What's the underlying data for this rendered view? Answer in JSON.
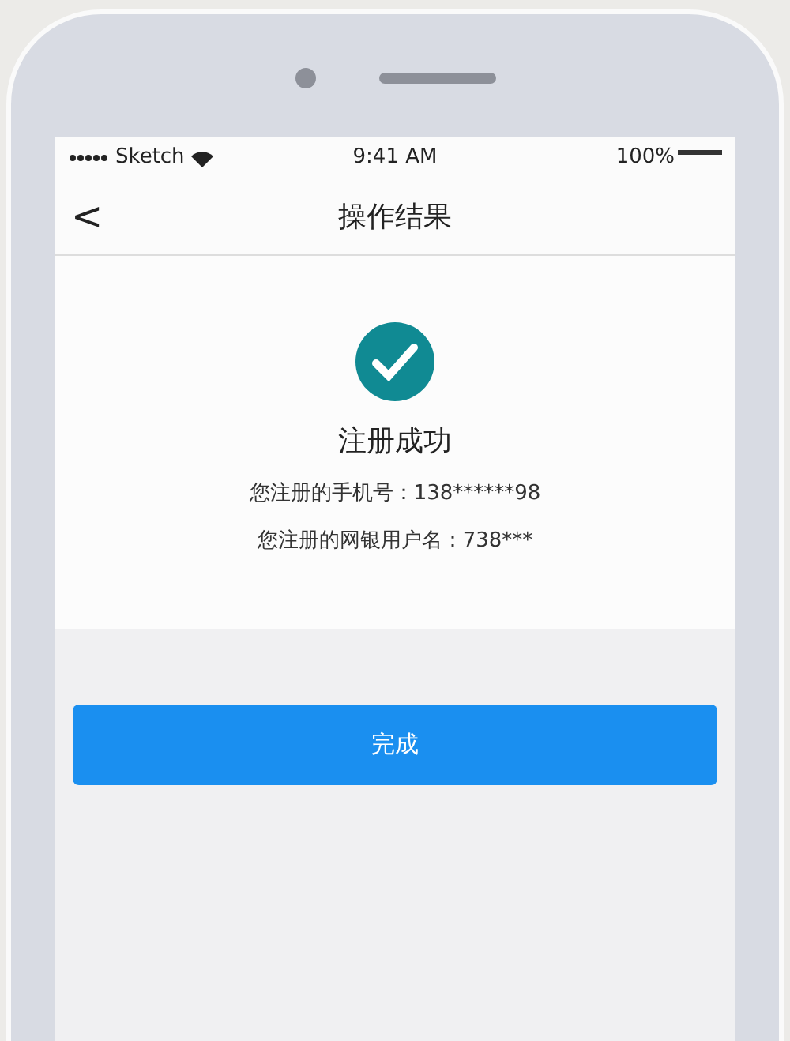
{
  "status_bar": {
    "carrier": "Sketch",
    "time": "9:41 AM",
    "battery": "100%"
  },
  "nav": {
    "back": "<",
    "title": "操作结果"
  },
  "result": {
    "title": "注册成功",
    "lines": [
      "您注册的手机号：138******98",
      "您注册的网银用户名：738***"
    ]
  },
  "button": "完成"
}
